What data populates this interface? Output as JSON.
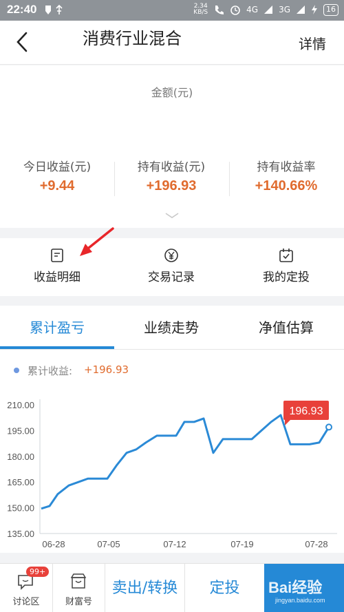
{
  "status_bar": {
    "time": "22:40",
    "speed_value": "2.34",
    "speed_unit": "KB/S",
    "signal1": "4G",
    "signal2": "3G",
    "battery": "16"
  },
  "nav": {
    "title": "消费行业混合",
    "detail": "详情"
  },
  "summary": {
    "amount_label": "金额(元)",
    "stats": [
      {
        "label": "今日收益(元)",
        "value": "+9.44"
      },
      {
        "label": "持有收益(元)",
        "value": "+196.93"
      },
      {
        "label": "持有收益率",
        "value": "+140.66%"
      }
    ]
  },
  "menu": [
    {
      "label": "收益明细",
      "icon": "document-icon"
    },
    {
      "label": "交易记录",
      "icon": "yen-circle-icon"
    },
    {
      "label": "我的定投",
      "icon": "calendar-check-icon"
    }
  ],
  "tabs": [
    "累计盈亏",
    "业绩走势",
    "净值估算"
  ],
  "legend": {
    "label": "累计收益:",
    "value": "+196.93"
  },
  "colors": {
    "accent": "#2589d6",
    "gain": "#e06b2e",
    "tooltip": "#e8413a"
  },
  "chart_data": {
    "type": "line",
    "y_ticks": [
      "210.00",
      "195.00",
      "180.00",
      "165.00",
      "150.00",
      "135.00"
    ],
    "x_ticks": [
      "06-28",
      "07-05",
      "07-12",
      "07-19",
      "07-28"
    ],
    "ylim": [
      135,
      210
    ],
    "tooltip": "196.93",
    "series": [
      {
        "values": [
          149.5,
          151,
          158,
          163,
          165,
          167,
          167,
          167,
          175,
          182,
          184,
          188,
          192,
          192,
          192,
          200,
          200,
          202,
          182,
          190,
          190,
          190,
          190,
          195,
          200,
          204,
          187,
          187,
          187,
          188,
          197
        ]
      }
    ]
  },
  "bottom_bar": {
    "forum": "讨论区",
    "forum_badge": "99+",
    "wealth": "财富号",
    "sell": "卖出/转换",
    "invest": "定投",
    "watermark": "Bai经验",
    "watermark_url": "jingyan.baidu.com"
  }
}
